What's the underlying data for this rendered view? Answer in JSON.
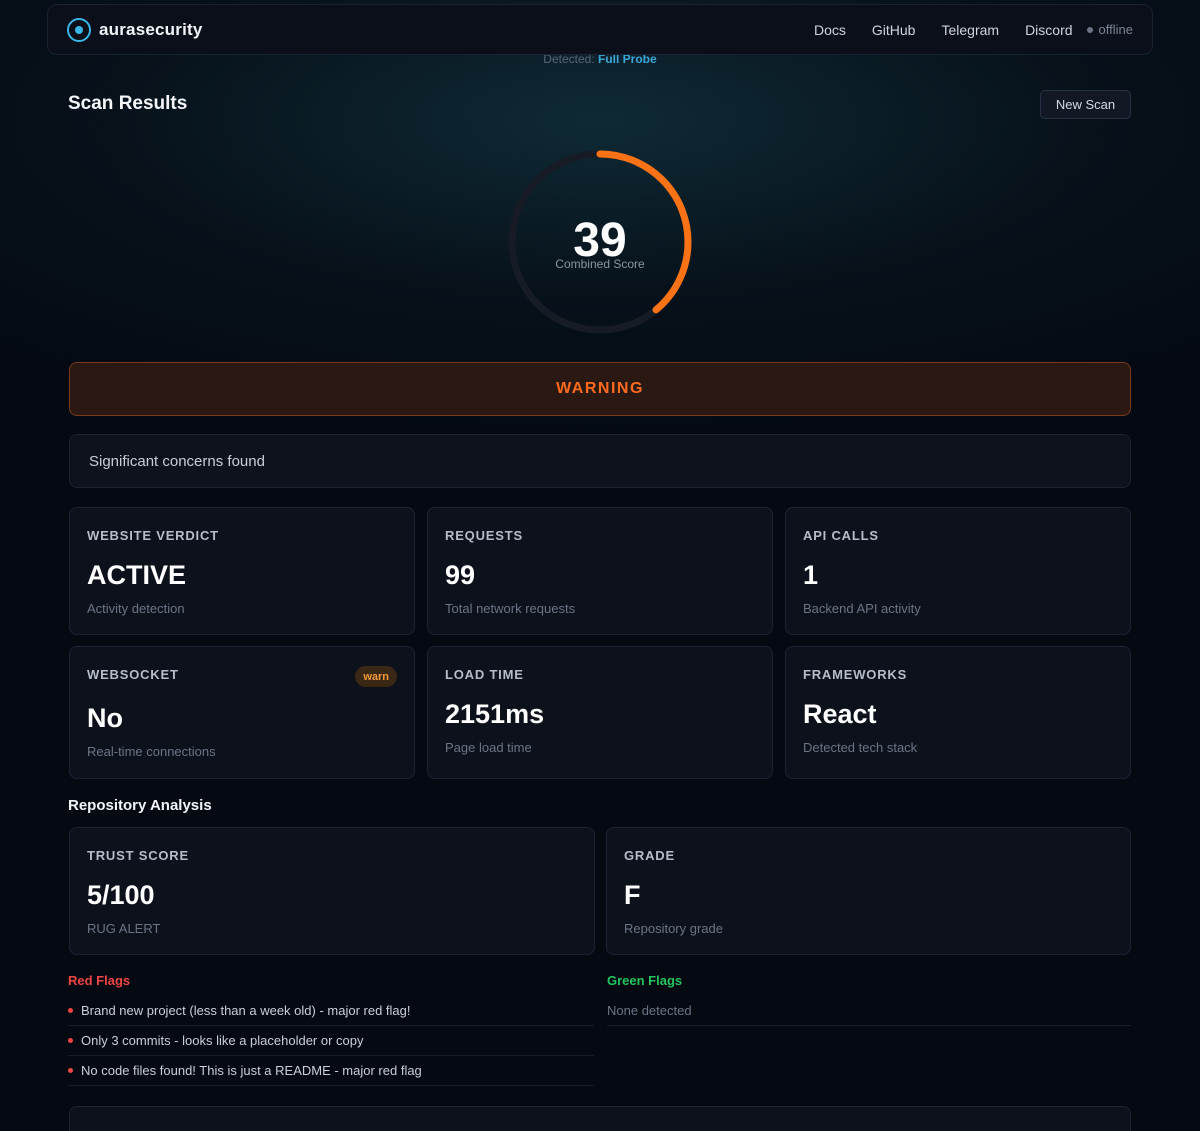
{
  "app": {
    "brand": "aurasecurity",
    "nav": [
      "Docs",
      "GitHub",
      "Telegram",
      "Discord"
    ],
    "status": "offline"
  },
  "detected": {
    "prefix": "Detected:",
    "value": "Full Probe"
  },
  "page": {
    "title": "Scan Results",
    "new_scan_label": "New Scan"
  },
  "score": {
    "value": "39",
    "fraction": 0.39,
    "label": "Combined Score",
    "color": "#f97316",
    "track_color": "#161b26"
  },
  "verdict_banner": "WARNING",
  "summary": "Significant concerns found",
  "metrics": [
    {
      "label": "WEBSITE VERDICT",
      "value": "ACTIVE",
      "sub": "Activity detection"
    },
    {
      "label": "REQUESTS",
      "value": "99",
      "sub": "Total network requests"
    },
    {
      "label": "API CALLS",
      "value": "1",
      "sub": "Backend API activity"
    },
    {
      "label": "WEBSOCKET",
      "value": "No",
      "sub": "Real-time connections",
      "badge": "warn"
    },
    {
      "label": "LOAD TIME",
      "value": "2151ms",
      "sub": "Page load time"
    },
    {
      "label": "FRAMEWORKS",
      "value": "React",
      "sub": "Detected tech stack"
    }
  ],
  "repo": {
    "title": "Repository Analysis",
    "trust": {
      "label": "TRUST SCORE",
      "value": "5/100",
      "sub": "RUG ALERT"
    },
    "grade": {
      "label": "GRADE",
      "value": "F",
      "sub": "Repository grade"
    }
  },
  "flags": {
    "red_title": "Red Flags",
    "red": [
      "Brand new project (less than a week old) - major red flag!",
      "Only 3 commits - looks like a placeholder or copy",
      "No code files found! This is just a README - major red flag"
    ],
    "green_title": "Green Flags",
    "green_none": "None detected"
  },
  "colors": {
    "accent": "#38b6e8",
    "warning": "#ff6a1f",
    "red": "#ef4444",
    "green": "#22c55e"
  }
}
